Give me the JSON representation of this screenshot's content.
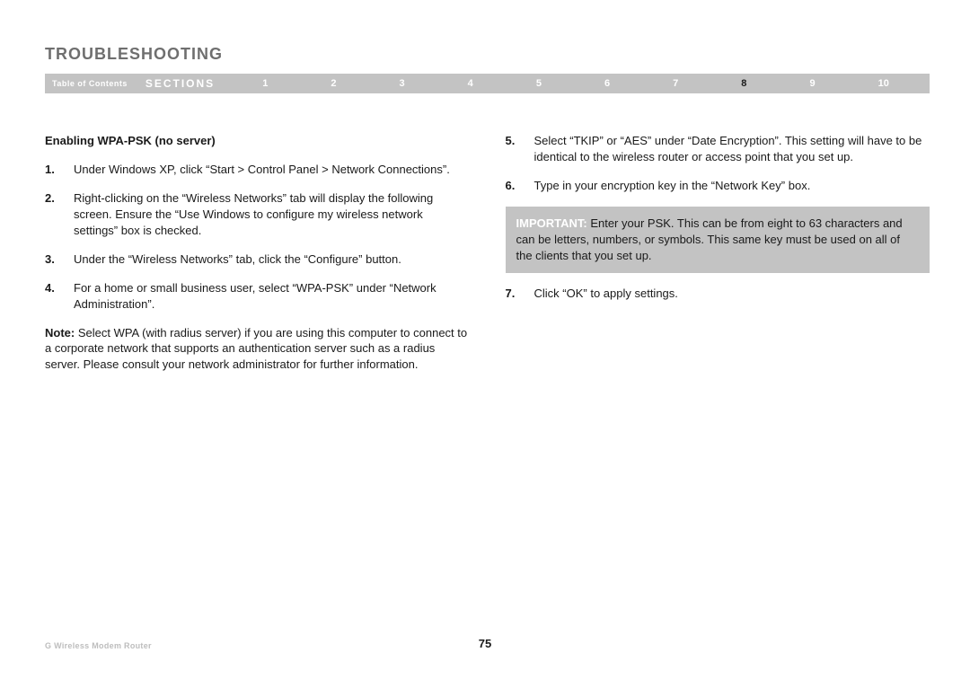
{
  "title": "TROUBLESHOOTING",
  "nav": {
    "toc": "Table of Contents",
    "sections": "SECTIONS",
    "items": [
      "1",
      "2",
      "3",
      "4",
      "5",
      "6",
      "7",
      "8",
      "9",
      "10"
    ],
    "active": "8"
  },
  "subhead": "Enabling WPA-PSK (no server)",
  "left": {
    "i1": {
      "n": "1.",
      "t": "Under Windows XP, click “Start > Control Panel > Network Connections”."
    },
    "i2": {
      "n": "2.",
      "t": "Right-clicking on the “Wireless Networks” tab will display the following screen. Ensure the “Use Windows to configure my wireless network settings” box is checked."
    },
    "i3": {
      "n": "3.",
      "t": "Under the “Wireless Networks” tab, click the “Configure” button."
    },
    "i4": {
      "n": "4.",
      "t": "For a home or small business user, select “WPA-PSK” under “Network Administration”."
    },
    "note_label": "Note:",
    "note_text": " Select WPA (with radius server) if you are using this computer to connect to a corporate network that supports an authentication server such as a radius server. Please consult your network administrator for further information."
  },
  "right": {
    "i5": {
      "n": "5.",
      "t": "Select “TKIP” or “AES” under “Date Encryption”. This setting will have to be identical to the wireless router or access point that you set up."
    },
    "i6": {
      "n": "6.",
      "t": "Type in your encryption key in the “Network Key” box."
    },
    "callout_label": "IMPORTANT:",
    "callout_text": " Enter your PSK. This can be from eight to 63 characters and can be letters, numbers, or symbols. This same key must be used on all of the clients that you set up.",
    "i7": {
      "n": "7.",
      "t": "Click “OK” to apply settings."
    }
  },
  "footer": {
    "product": "G Wireless Modem Router",
    "page": "75"
  }
}
